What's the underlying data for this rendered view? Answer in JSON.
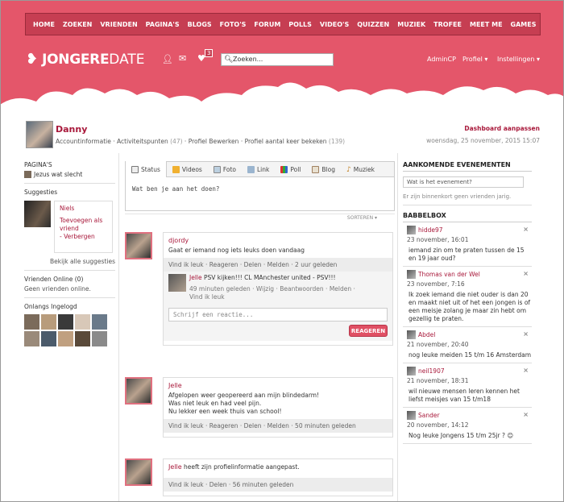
{
  "nav": [
    "HOME",
    "ZOEKEN",
    "VRIENDEN",
    "PAGINA'S",
    "BLOGS",
    "FOTO'S",
    "FORUM",
    "POLLS",
    "VIDEO'S",
    "QUIZZEN",
    "MUZIEK",
    "TROFEE",
    "MEET ME",
    "GAMES"
  ],
  "logo": {
    "part1": "JONGERE",
    "part2": "DATE"
  },
  "header": {
    "notif_count": "3",
    "search_placeholder": "Zoeken...",
    "admincp": "AdminCP",
    "profiel": "Profiel ▾",
    "instellingen": "Instellingen ▾"
  },
  "profile": {
    "name": "Danny",
    "link1": "Accountinformatie",
    "link2": "Activiteitspunten",
    "link2_count": "(47)",
    "link3": "Profiel Bewerken",
    "link4": "Profiel aantal keer bekeken",
    "link4_count": "(139)",
    "dashboard": "Dashboard aanpassen",
    "date": "woensdag, 25 november, 2015 15:07"
  },
  "left": {
    "pages_heading": "PAGINA'S",
    "page_item": "Jezus wat slecht",
    "suggestions_heading": "Suggesties",
    "sug_name": "Niels",
    "sug_add": "Toevoegen als vriend",
    "sug_hide": "Verbergen",
    "all_suggestions": "Bekijk alle suggesties",
    "online_heading": "Vrienden Online (0)",
    "online_none": "Geen vrienden online.",
    "recent_heading": "Onlangs Ingelogd"
  },
  "tabs": [
    "Status",
    "Videos",
    "Foto",
    "Link",
    "Poll",
    "Blog",
    "Muziek"
  ],
  "status_placeholder": "Wat ben je aan het doen?",
  "sorter": "SORTEREN ▾",
  "posts": [
    {
      "name": "djordy",
      "text": "Gaat er iemand nog iets leuks doen vandaag",
      "actions": "Vind ik leuk · Reageren · Delen · Melden · 2 uur geleden"
    },
    {
      "name": "Jelle",
      "text": "Afgelopen weer geopereerd aan mijn blindedarm!\nWas niet leuk en had veel pijn.\nNu lekker een week thuis van school!",
      "actions": "Vind ik leuk · Reageren · Delen · Melden · 50 minuten geleden"
    },
    {
      "name": "Jelle",
      "text": "heeft zijn profielinformatie aangepast.",
      "actions": "Vind ik leuk · Delen · 56 minuten geleden"
    }
  ],
  "comment": {
    "name": "Jelle",
    "text": "PSV kijken!!! CL MAnchester united - PSV!!!",
    "meta": "49 minuten geleden · Wijzig · Beantwoorden · Melden ·",
    "like": "Vind ik leuk"
  },
  "reply": {
    "placeholder": "Schrijf een reactie...",
    "button": "REAGEREN"
  },
  "events": {
    "heading": "AANKOMENDE EVENEMENTEN",
    "input": "Wat is het evenement?",
    "empty": "Er zijn binnenkort geen vrienden jarig."
  },
  "babbelbox": {
    "heading": "BABBELBOX",
    "messages": [
      {
        "user": "hidde97",
        "time": "23 november, 16:01",
        "text": "iemand zin om te praten tussen de 15 en 19 jaar oud?"
      },
      {
        "user": "Thomas van der Wel",
        "time": "23 november, 7:16",
        "text": "Ik zoek iemand die niet ouder is dan 20 en maakt niet uit of het een jongen is of een meisje zolang je maar zin hebt om gezellig te praten."
      },
      {
        "user": "Abdel",
        "time": "21 november, 20:40",
        "text": "nog leuke meiden 15 t/m 16 Amsterdam"
      },
      {
        "user": "neil1907",
        "time": "21 november, 18:31",
        "text": "wil nieuwe mensen leren kennen het liefst meisjes van 15 t/m18"
      },
      {
        "user": "Sander",
        "time": "20 november, 14:12",
        "text": "Nog leuke Jongens 15 t/m 25jr ? 😊"
      }
    ]
  }
}
